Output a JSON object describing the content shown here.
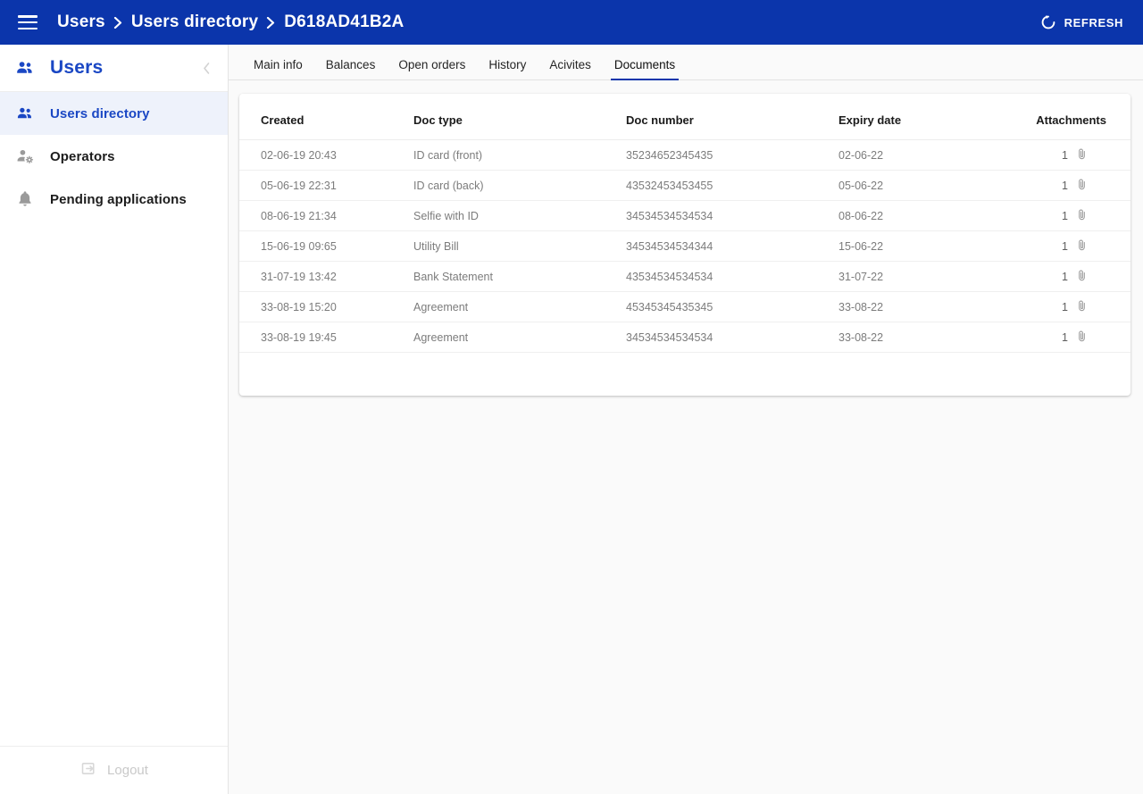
{
  "topbar": {
    "menu_icon": "hamburger-icon",
    "breadcrumb": [
      {
        "label": "Users"
      },
      {
        "label": "Users directory"
      },
      {
        "label": "D618AD41B2A"
      }
    ],
    "separator": ">",
    "refresh_label": "REFRESH",
    "refresh_icon": "refresh-icon",
    "background_color": "#0b35ab",
    "text_color": "#ffffff"
  },
  "sidebar": {
    "title": "Users",
    "title_icon": "people-icon",
    "collapse_icon": "chevron-left-icon",
    "items": [
      {
        "label": "Users directory",
        "icon": "people-icon",
        "active": true
      },
      {
        "label": "Operators",
        "icon": "person-gear-icon",
        "active": false
      },
      {
        "label": "Pending applications",
        "icon": "bell-icon",
        "active": false
      }
    ],
    "logout_label": "Logout",
    "logout_icon": "logout-arrow-icon",
    "active_color": "#1a47c4",
    "active_background": "#eef2fb"
  },
  "tabs": [
    {
      "label": "Main info",
      "active": false
    },
    {
      "label": "Balances",
      "active": false
    },
    {
      "label": "Open orders",
      "active": false
    },
    {
      "label": "History",
      "active": false
    },
    {
      "label": "Acivites",
      "active": false
    },
    {
      "label": "Documents",
      "active": true
    }
  ],
  "table": {
    "columns": [
      "Created",
      "Doc type",
      "Doc number",
      "Expiry date",
      "Attachments"
    ],
    "attachment_icon": "paperclip-icon",
    "rows": [
      {
        "created": "02-06-19 20:43",
        "doc_type": "ID card (front)",
        "doc_number": "35234652345435",
        "expiry_date": "02-06-22",
        "attachments": "1"
      },
      {
        "created": "05-06-19 22:31",
        "doc_type": "ID card (back)",
        "doc_number": "43532453453455",
        "expiry_date": "05-06-22",
        "attachments": "1"
      },
      {
        "created": "08-06-19 21:34",
        "doc_type": "Selfie with ID",
        "doc_number": "34534534534534",
        "expiry_date": "08-06-22",
        "attachments": "1"
      },
      {
        "created": "15-06-19 09:65",
        "doc_type": "Utility Bill",
        "doc_number": "34534534534344",
        "expiry_date": "15-06-22",
        "attachments": "1"
      },
      {
        "created": "31-07-19 13:42",
        "doc_type": "Bank Statement",
        "doc_number": "43534534534534",
        "expiry_date": "31-07-22",
        "attachments": "1"
      },
      {
        "created": "33-08-19 15:20",
        "doc_type": "Agreement",
        "doc_number": "45345345435345",
        "expiry_date": "33-08-22",
        "attachments": "1"
      },
      {
        "created": "33-08-19 19:45",
        "doc_type": "Agreement",
        "doc_number": "34534534534534",
        "expiry_date": "33-08-22",
        "attachments": "1"
      }
    ]
  }
}
